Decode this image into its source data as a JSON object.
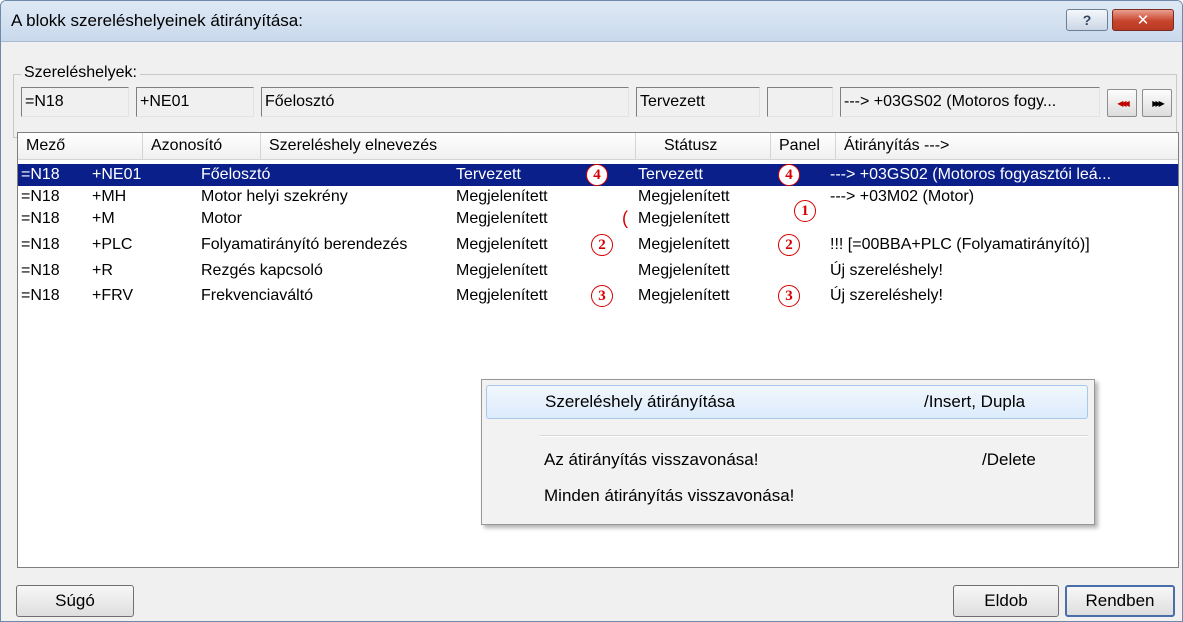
{
  "window": {
    "title": "A blokk szereléshelyeinek átirányítása:",
    "help_glyph": "?",
    "close_glyph": "✕"
  },
  "group": {
    "label": "Szereléshelyek:",
    "fields": {
      "mezo": "=N18",
      "azonosito": "+NE01",
      "elnevezes": "Főelosztó",
      "statusz": "Tervezett",
      "panel": "",
      "atiranyitas": "---> +03GS02 (Motoros fogy..."
    },
    "prev_glyph": "◀◀◀",
    "next_glyph": "▶▶▶"
  },
  "list": {
    "columns": [
      "Mező",
      "Azonosító",
      "Szereléshely elnevezés",
      "Státusz",
      "Panel",
      "Átirányítás --->"
    ],
    "rows": [
      {
        "mezo": "=N18",
        "azon": "+NE01",
        "nev": "Főelosztó",
        "statusz1": "Tervezett",
        "mark1": "4",
        "statusz2": "Tervezett",
        "mark2": "4",
        "atir": "---> +03GS02 (Motoros fogyasztói leá..."
      },
      {
        "mezo": "=N18",
        "azon": "+MH",
        "nev": "Motor helyi szekrény",
        "statusz1": "Megjelenített",
        "mark1": "",
        "statusz2": "Megjelenített",
        "mark2": "",
        "atir": "---> +03M02 (Motor)"
      },
      {
        "mezo": "=N18",
        "azon": "+M",
        "nev": "Motor",
        "statusz1": "Megjelenített",
        "mark1": "(",
        "statusz2": "Megjelenített",
        "mark2": "1",
        "atir": ""
      },
      {
        "mezo": "=N18",
        "azon": "+PLC",
        "nev": "Folyamatirányító berendezés",
        "statusz1": "Megjelenített",
        "mark1": "2",
        "statusz2": "Megjelenített",
        "mark2": "2",
        "atir": "!!! [=00BBA+PLC (Folyamatirányító)]"
      },
      {
        "mezo": "=N18",
        "azon": "+R",
        "nev": "Rezgés kapcsoló",
        "statusz1": "Megjelenített",
        "mark1": "",
        "statusz2": "Megjelenített",
        "mark2": "",
        "atir": "Új szereléshely!"
      },
      {
        "mezo": "=N18",
        "azon": "+FRV",
        "nev": "Frekvenciaváltó",
        "statusz1": "Megjelenített",
        "mark1": "3",
        "statusz2": "Megjelenített",
        "mark2": "3",
        "atir": "Új szereléshely!"
      }
    ]
  },
  "context_menu": {
    "items": [
      {
        "label": "Szereléshely átirányítása",
        "shortcut": "/Insert, Dupla"
      },
      {
        "label": "Az átirányítás visszavonása!",
        "shortcut": "/Delete"
      },
      {
        "label": "Minden átirányítás visszavonása!",
        "shortcut": ""
      }
    ]
  },
  "buttons": {
    "sugo": "Súgó",
    "eldob": "Eldob",
    "rendben": "Rendben"
  },
  "colors": {
    "selection": "#0a1f8a",
    "marker": "#d40000"
  }
}
